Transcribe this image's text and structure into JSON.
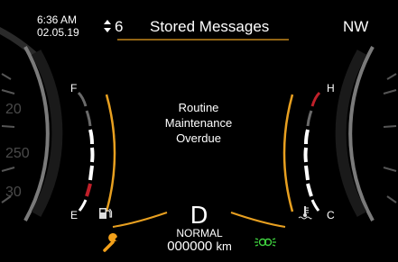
{
  "clock": {
    "time": "6:36 AM",
    "date": "02.05.19"
  },
  "header": {
    "count": "6",
    "title": "Stored Messages",
    "compass": "NW",
    "arrows_icon": "up-down-arrows-icon"
  },
  "alert": {
    "line1": "Routine",
    "line2": "Maintenance",
    "line3": "Overdue"
  },
  "fuel_gauge": {
    "full_label": "F",
    "empty_label": "E",
    "icon": "fuel-pump-icon",
    "segments": 8
  },
  "temp_gauge": {
    "hot_label": "H",
    "cold_label": "C",
    "icon": "coolant-temperature-icon",
    "segments": 8
  },
  "transmission": {
    "gear": "D",
    "mode": "NORMAL"
  },
  "odometer": {
    "value": "000000",
    "unit": "km"
  },
  "indicators": {
    "service_icon": "wrench-icon",
    "service_color": "#f2a01a",
    "lamp_icon": "parking-lights-icon",
    "lamp_color": "#3ecf3e"
  },
  "dial_numbers": {
    "upper": "20",
    "middle": "250",
    "lower": "30"
  },
  "colors": {
    "accent": "#e8a020",
    "red_segment": "#c0202a",
    "gray_segment": "#6a6a6a"
  }
}
